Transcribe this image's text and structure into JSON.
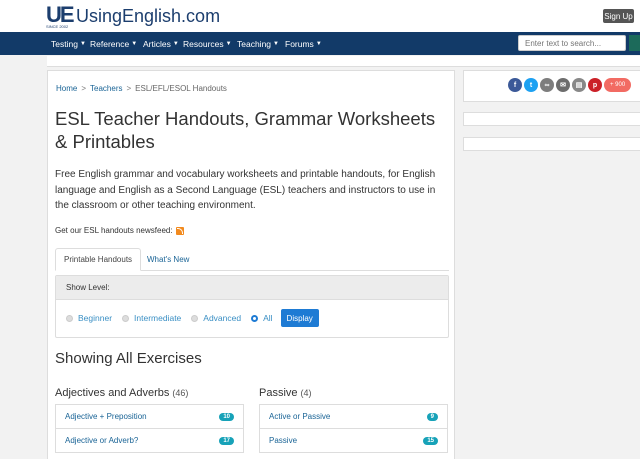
{
  "site": {
    "logo_mark": "UE",
    "logo_since": "SINCE 2002",
    "name": "UsingEnglish.com",
    "signup": "Sign Up"
  },
  "nav": {
    "items": [
      "Testing",
      "Reference",
      "Articles",
      "Resources",
      "Teaching",
      "Forums"
    ],
    "search_placeholder": "Enter text to search..."
  },
  "breadcrumb": {
    "home": "Home",
    "teachers": "Teachers",
    "current": "ESL/EFL/ESOL Handouts",
    "sep": ">"
  },
  "page": {
    "title": "ESL Teacher Handouts, Grammar Worksheets & Printables",
    "intro": "Free English grammar and vocabulary worksheets and printable handouts, for English language and English as a Second Language (ESL) teachers and instructors to use in the classroom or other teaching environment.",
    "feed_text": "Get our ESL handouts newsfeed:"
  },
  "tabs": {
    "printable": "Printable Handouts",
    "whats_new": "What's New"
  },
  "level": {
    "label": "Show Level:",
    "options": [
      "Beginner",
      "Intermediate",
      "Advanced",
      "All"
    ],
    "selected": "All",
    "display": "Display"
  },
  "showing": "Showing All Exercises",
  "categories": [
    {
      "name": "Adjectives and Adverbs",
      "count": "(46)",
      "items": [
        {
          "label": "Adjective + Preposition",
          "count": "10"
        },
        {
          "label": "Adjective or Adverb?",
          "count": "17"
        }
      ]
    },
    {
      "name": "Passive",
      "count": "(4)",
      "items": [
        {
          "label": "Active or Passive",
          "count": "9"
        },
        {
          "label": "Passive",
          "count": "15"
        }
      ]
    }
  ],
  "share": {
    "count": "+ 900",
    "colors": {
      "facebook": "#3b5998",
      "twitter": "#1da1f2",
      "link": "#7d7d7d",
      "email": "#6d6d6d",
      "print": "#888888",
      "pinterest": "#cb2027",
      "plus": "#f26b63"
    }
  }
}
